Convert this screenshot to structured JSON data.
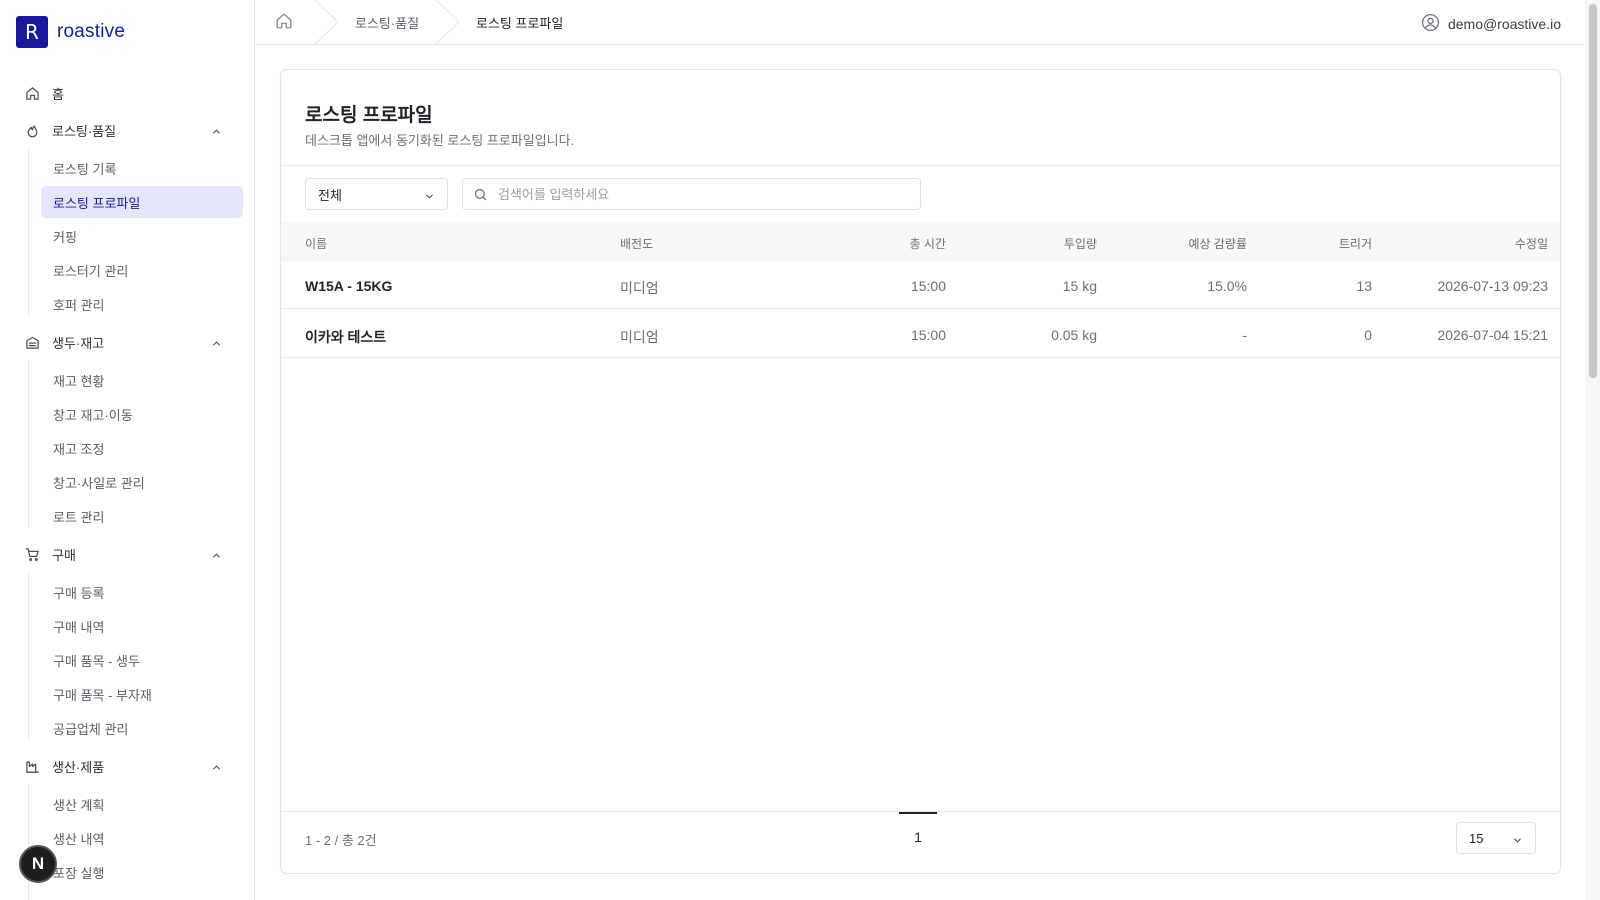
{
  "brand": {
    "logo_letter": "R",
    "name": "roastive"
  },
  "sidebar": {
    "home": "홈",
    "sections": [
      {
        "label": "로스팅·품질",
        "icon": "flame-icon",
        "items": [
          "로스팅 기록",
          "로스팅 프로파일",
          "커핑",
          "로스터기 관리",
          "호퍼 관리"
        ]
      },
      {
        "label": "생두·재고",
        "icon": "warehouse-icon",
        "items": [
          "재고 현황",
          "창고 재고·이동",
          "재고 조정",
          "창고·사일로 관리",
          "로트 관리"
        ]
      },
      {
        "label": "구매",
        "icon": "cart-icon",
        "items": [
          "구매 등록",
          "구매 내역",
          "구매 품목 - 생두",
          "구매 품목 - 부자재",
          "공급업체 관리"
        ]
      },
      {
        "label": "생산·제품",
        "icon": "factory-icon",
        "items": [
          "생산 계획",
          "생산 내역",
          "포장 실행"
        ]
      }
    ],
    "active_item": "로스팅 프로파일"
  },
  "breadcrumb": {
    "items": [
      "로스팅·품질",
      "로스팅 프로파일"
    ]
  },
  "user": {
    "email": "demo@roastive.io"
  },
  "page": {
    "title": "로스팅 프로파일",
    "description": "데스크톱 앱에서 동기화된 로스팅 프로파일입니다."
  },
  "filters": {
    "category_value": "전체",
    "search_placeholder": "검색어를 입력하세요"
  },
  "table": {
    "columns": [
      "이름",
      "배전도",
      "총 시간",
      "투입량",
      "예상 감량률",
      "트리거",
      "수정일"
    ],
    "rows": [
      [
        "W15A - 15KG",
        "미디엄",
        "15:00",
        "15 kg",
        "15.0%",
        "13",
        "2026-07-13 09:23"
      ],
      [
        "이카와 테스트",
        "미디엄",
        "15:00",
        "0.05 kg",
        "-",
        "0",
        "2026-07-04 15:21"
      ]
    ]
  },
  "pagination": {
    "summary": "1 - 2 / 총 2건",
    "current_page": "1",
    "page_size": "15"
  },
  "fab": {
    "label": "N"
  },
  "colors": {
    "brand": "#1a1aa0",
    "active_bg": "#e6e6fa"
  }
}
